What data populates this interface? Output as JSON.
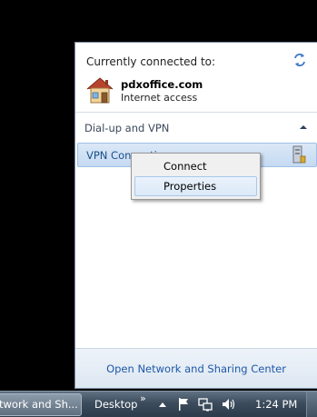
{
  "flyout": {
    "header": "Currently connected to:",
    "network_name": "pdxoffice.com",
    "network_status": "Internet access",
    "section_title": "Dial-up and VPN",
    "vpn_name": "VPN Connection",
    "footer_link": "Open Network and Sharing Center"
  },
  "context_menu": {
    "items": [
      "Connect",
      "Properties"
    ],
    "highlighted": "Properties"
  },
  "taskbar": {
    "task_button": "twork and Sh...",
    "toolbar_label": "Desktop",
    "toolbar_chevron": "»",
    "clock": "1:24 PM"
  },
  "icons": [
    "refresh-icon",
    "house-network-icon",
    "collapse-chevron-icon",
    "vpn-icon",
    "tray-up-arrow-icon",
    "flag-icon",
    "network-tray-icon",
    "speaker-icon"
  ]
}
